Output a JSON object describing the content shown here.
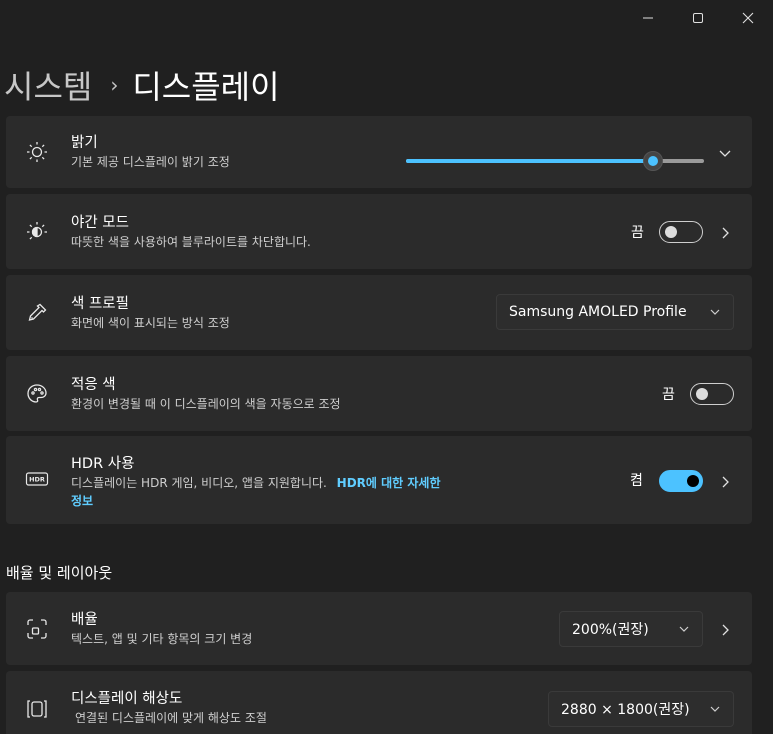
{
  "window": {
    "controls": [
      "minimize-icon",
      "maximize-icon",
      "close-icon"
    ]
  },
  "breadcrumb": {
    "parent": "시스템",
    "separator": "›",
    "current": "디스플레이"
  },
  "brightness": {
    "title": "밝기",
    "description": "기본 제공 디스플레이 밝기 조정",
    "level_percent": 83,
    "icon": "sun-icon"
  },
  "night_light": {
    "title": "야간 모드",
    "description": "따뜻한 색을 사용하여 블루라이트를 차단합니다.",
    "state": "끔",
    "on": false,
    "icon": "night-light-icon"
  },
  "color_profile": {
    "title": "색 프로필",
    "description": "화면에 색이 표시되는 방식 조정",
    "selected": "Samsung AMOLED Profile",
    "icon": "dropper-icon"
  },
  "adaptive_color": {
    "title": "적응 색",
    "description": "환경이 변경될 때 이 디스플레이의 색을 자동으로 조정",
    "state": "끔",
    "on": false,
    "icon": "palette-icon"
  },
  "hdr": {
    "title": "HDR 사용",
    "description": "디스플레이는 HDR 게임, 비디오, 앱을 지원합니다.",
    "link_line1": "HDR에 대한 자세한",
    "link_line2": "정보",
    "state": "켬",
    "on": true,
    "icon": "hdr-icon"
  },
  "layout_section": {
    "title": "배율 및 레이아웃"
  },
  "scale": {
    "title": "배율",
    "description": "텍스트, 앱 및 기타 항목의 크기 변경",
    "selected": "200%(권장)",
    "icon": "scale-icon"
  },
  "resolution": {
    "title": "디스플레이 해상도",
    "description": "연결된 디스플레이에 맞게 해상도 조절",
    "selected": "2880 × 1800(권장)",
    "icon": "resolution-icon"
  },
  "colors": {
    "accent": "#4cc2ff",
    "link": "#60cdff",
    "card": "#2b2b2b",
    "background": "#202020"
  }
}
